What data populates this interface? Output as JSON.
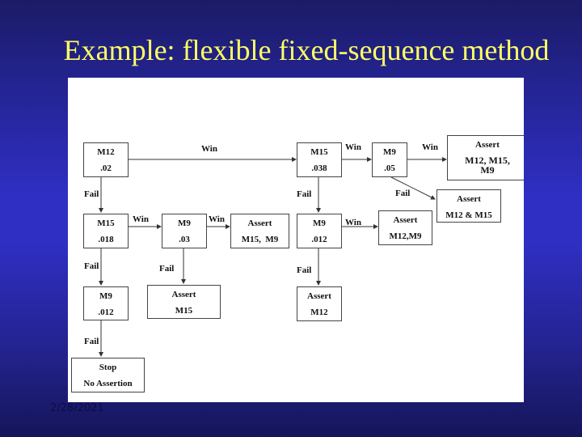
{
  "slide": {
    "title": "Example: flexible fixed-sequence method",
    "date": "2/28/2021"
  },
  "diagram": {
    "nodes": {
      "m12_top": {
        "name": "M12",
        "value": ".02"
      },
      "m15_top": {
        "name": "M15",
        "value": ".038"
      },
      "m9_top": {
        "name": "M9",
        "value": ".05"
      },
      "assert_all": {
        "name": "Assert",
        "value": "M12, M15, M9"
      },
      "assert_m12_m15": {
        "name": "Assert",
        "value": "M12 & M15"
      },
      "m15_mid": {
        "name": "M15",
        "value": ".018"
      },
      "m9_mid": {
        "name": "M9",
        "value": ".03"
      },
      "assert_m15_m9": {
        "name": "Assert",
        "value": "M15,  M9"
      },
      "m9_mid_right": {
        "name": "M9",
        "value": ".012"
      },
      "assert_m12_m9": {
        "name": "Assert",
        "value": "M12,M9"
      },
      "m9_low": {
        "name": "M9",
        "value": ".012"
      },
      "assert_m15": {
        "name": "Assert",
        "value": "M15"
      },
      "assert_m12": {
        "name": "Assert",
        "value": "M12"
      },
      "stop": {
        "name": "Stop",
        "value": "No Assertion"
      }
    },
    "edge_labels": {
      "win": "Win",
      "fail": "Fail"
    }
  }
}
